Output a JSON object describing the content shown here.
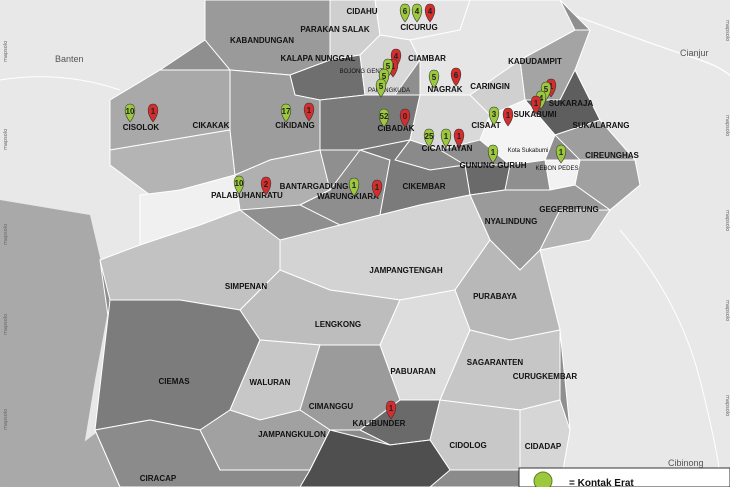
{
  "map": {
    "outside_labels": {
      "banten": "Banten",
      "cianjur": "Cianjur",
      "cibinong": "Cibinong"
    },
    "watermark": "mapsolo",
    "districts": {
      "cidahu": "CIDAHU",
      "parakansalak": "PARAKAN SALAK",
      "cicurug": "CICURUG",
      "kabandungan": "KABANDUNGAN",
      "kalapanunggal": "KALAPA NUNGGAL",
      "ciambar": "CIAMBAR",
      "bojonggenteng": "BOJONG GENTENG",
      "parungkuda": "PARUNGKUDA",
      "nagrak": "NAGRAK",
      "caringin": "CARINGIN",
      "kadudampit": "KADUDAMPIT",
      "sukaraja": "SUKARAJA",
      "sukabumi": "SUKABUMI",
      "sukalarang": "SUKALARANG",
      "cisolok": "CISOLOK",
      "cikakak": "CIKAKAK",
      "cikidang": "CIKIDANG",
      "cibadak": "CIBADAK",
      "cisaat": "CISAAT",
      "cicantayan": "CICANTAYAN",
      "kotasukabumi": "Kota Sukabumi",
      "gunungguruh": "GUNUNG GURUH",
      "kebonpedes": "KEBON PEDES",
      "cireunghas": "CIREUNGHAS",
      "palabuhanratu": "PALABUHANRATU",
      "bantargadung": "BANTARGADUNG",
      "warungkiara": "WARUNGKIARA",
      "cikembar": "CIKEMBAR",
      "gegerbitung": "GEGERBITUNG",
      "nyalindung": "NYALINDUNG",
      "jampangtengah": "JAMPANGTENGAH",
      "simpenan": "SIMPENAN",
      "purabaya": "PURABAYA",
      "lengkong": "LENGKONG",
      "pabuaran": "PABUARAN",
      "sagaranten": "SAGARANTEN",
      "curugkembar": "CURUGKEMBAR",
      "ciemas": "CIEMAS",
      "waluran": "WALURAN",
      "cimanggu": "CIMANGGU",
      "jampangkulon": "JAMPANGKULON",
      "kalibunder": "KALIBUNDER",
      "cidolog": "CIDOLOG",
      "cidadap": "CIDADAP",
      "ciracap": "CIRACAP"
    },
    "markers": [
      {
        "id": "cicurug-g1",
        "type": "kontak-erat",
        "value": "6"
      },
      {
        "id": "cicurug-g2",
        "type": "kontak-erat",
        "value": "4"
      },
      {
        "id": "cicurug-r",
        "type": "positif",
        "value": "4"
      },
      {
        "id": "ciambar-r1",
        "type": "positif",
        "value": "4"
      },
      {
        "id": "ciambar-r2",
        "type": "positif",
        "value": "1"
      },
      {
        "id": "parung-g1",
        "type": "kontak-erat",
        "value": "5"
      },
      {
        "id": "parung-g2",
        "type": "kontak-erat",
        "value": "5"
      },
      {
        "id": "parung-g3",
        "type": "kontak-erat",
        "value": "5"
      },
      {
        "id": "nagrak-g",
        "type": "kontak-erat",
        "value": "5"
      },
      {
        "id": "nagrak-r",
        "type": "positif",
        "value": "6"
      },
      {
        "id": "sukaraja-r",
        "type": "positif",
        "value": "1"
      },
      {
        "id": "sukabumi-g1",
        "type": "kontak-erat",
        "value": "5"
      },
      {
        "id": "sukabumi-g2",
        "type": "kontak-erat",
        "value": "4"
      },
      {
        "id": "sukabumi-r",
        "type": "positif",
        "value": "1"
      },
      {
        "id": "cisolok-g",
        "type": "kontak-erat",
        "value": "10"
      },
      {
        "id": "cisolok-r",
        "type": "positif",
        "value": "1"
      },
      {
        "id": "cikidang-g",
        "type": "kontak-erat",
        "value": "17"
      },
      {
        "id": "cikidang-r",
        "type": "positif",
        "value": "1"
      },
      {
        "id": "cibadak-g",
        "type": "kontak-erat",
        "value": "52"
      },
      {
        "id": "cibadak-r",
        "type": "positif",
        "value": "0"
      },
      {
        "id": "cisaat-g",
        "type": "kontak-erat",
        "value": "3"
      },
      {
        "id": "cisaat-r",
        "type": "positif",
        "value": "1"
      },
      {
        "id": "cicantayan-g1",
        "type": "kontak-erat",
        "value": "25"
      },
      {
        "id": "cicantayan-g2",
        "type": "kontak-erat",
        "value": "1"
      },
      {
        "id": "cicantayan-r",
        "type": "positif",
        "value": "1"
      },
      {
        "id": "gunungguruh-g",
        "type": "kontak-erat",
        "value": "1"
      },
      {
        "id": "kebonpedes-g",
        "type": "kontak-erat",
        "value": "1"
      },
      {
        "id": "palabuhanratu-g",
        "type": "kontak-erat",
        "value": "10"
      },
      {
        "id": "palabuhanratu-r",
        "type": "positif",
        "value": "2"
      },
      {
        "id": "warungkiara-g",
        "type": "kontak-erat",
        "value": "1"
      },
      {
        "id": "warungkiara-r",
        "type": "positif",
        "value": "1"
      },
      {
        "id": "kalibunder-r",
        "type": "positif",
        "value": "1"
      }
    ],
    "colors": {
      "kontak_erat": "#9bc83c",
      "positif": "#d42d2d",
      "sea": "#a8a8a8",
      "land_outside": "#e6e6e6"
    },
    "legend": {
      "kontak_erat_label": "= Kontak Erat"
    }
  }
}
